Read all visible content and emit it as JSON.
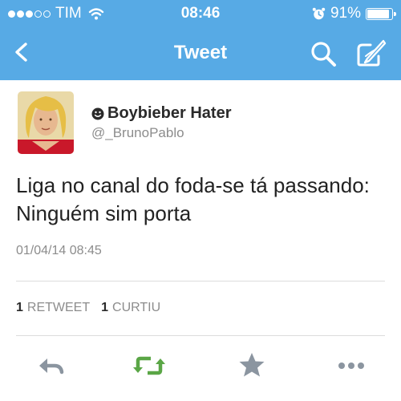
{
  "status_bar": {
    "carrier": "TIM",
    "time": "08:46",
    "battery": "91%",
    "battery_level": 0.91,
    "signal_filled": 3,
    "signal_total": 5,
    "icons": [
      "signal-dots-icon",
      "wifi-icon",
      "alarm-icon",
      "battery-icon"
    ]
  },
  "nav": {
    "title": "Tweet",
    "icons": [
      "back-chevron-icon",
      "search-icon",
      "compose-icon"
    ]
  },
  "tweet": {
    "display_name": "Boybieber Hater",
    "handle": "@_BrunoPablo",
    "text": "Liga no canal do foda-se tá passando: Ninguém sim porta",
    "timestamp": "01/04/14 08:45"
  },
  "stats": {
    "retweets_count": "1",
    "retweets_label": "RETWEET",
    "likes_count": "1",
    "likes_label": "CURTIU"
  },
  "actions": {
    "icons": [
      "reply-icon",
      "retweet-icon",
      "favorite-icon",
      "more-icon"
    ],
    "retweet_color": "#5aa646"
  },
  "colors": {
    "header": "#57aae5",
    "secondary_text": "#8c8c8c",
    "action_gray": "#8b95a0"
  }
}
